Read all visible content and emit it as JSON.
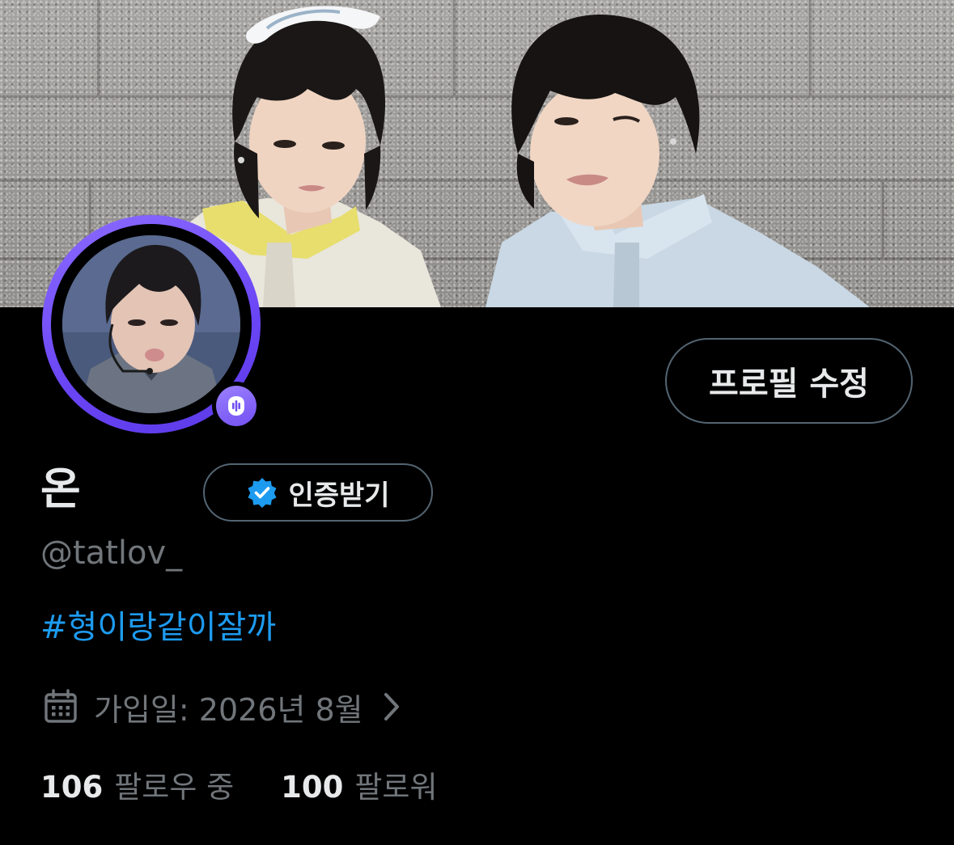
{
  "profile": {
    "display_name": "온",
    "handle": "@tatlov_",
    "bio": "#형이랑같이잘까",
    "edit_profile_label": "프로필 수정",
    "get_verified_label": "인증받기",
    "join_date": "가입일: 2026년 8월",
    "following_count": "106",
    "following_label": "팔로우 중",
    "followers_count": "100",
    "followers_label": "팔로워"
  },
  "icons": {
    "verified": "verified-badge-icon",
    "calendar": "calendar-icon",
    "chevron": "chevron-right-icon",
    "spaces": "spaces-mic-icon"
  },
  "colors": {
    "background": "#000000",
    "text_primary": "#e7e9ea",
    "text_secondary": "#71767b",
    "link": "#1d9bf0",
    "border": "#536471",
    "avatar_ring": "#6a45f5",
    "verified_blue": "#1d9bf0"
  }
}
